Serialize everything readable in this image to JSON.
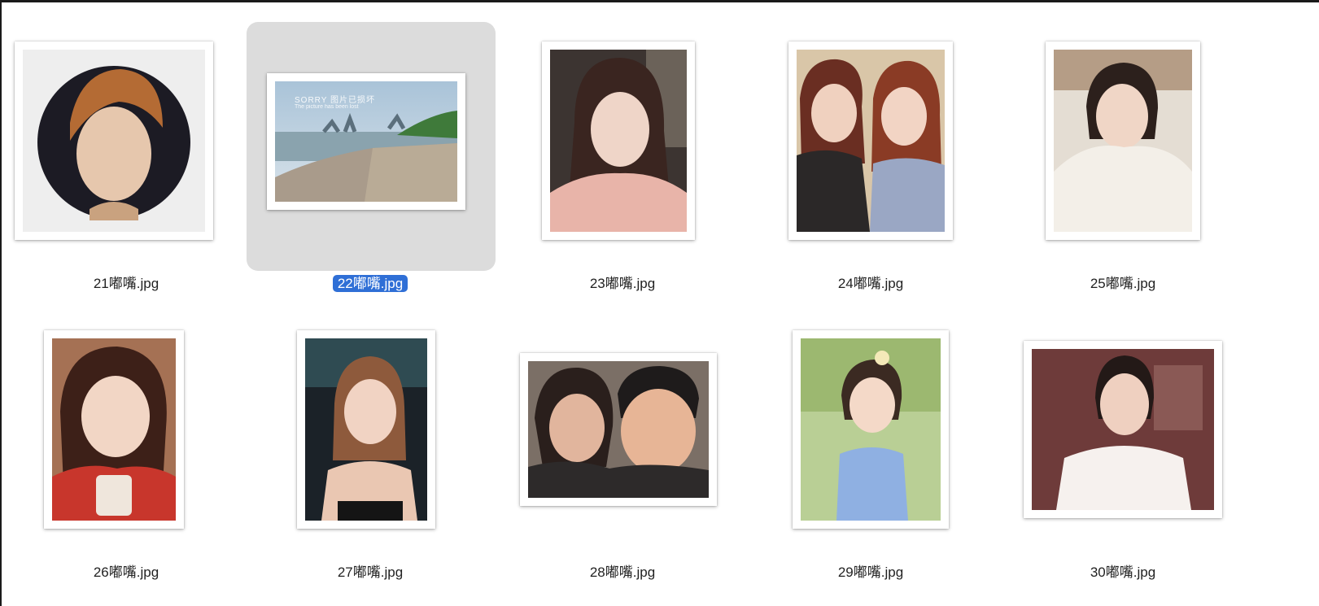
{
  "files": [
    {
      "name": "21嘟嘴.jpg",
      "selected": false
    },
    {
      "name": "22嘟嘴.jpg",
      "selected": true,
      "overlay_text": "SORRY 图片已损坏",
      "overlay_subtext": "The picture has been lost"
    },
    {
      "name": "23嘟嘴.jpg",
      "selected": false
    },
    {
      "name": "24嘟嘴.jpg",
      "selected": false
    },
    {
      "name": "25嘟嘴.jpg",
      "selected": false
    },
    {
      "name": "26嘟嘴.jpg",
      "selected": false
    },
    {
      "name": "27嘟嘴.jpg",
      "selected": false
    },
    {
      "name": "28嘟嘴.jpg",
      "selected": false
    },
    {
      "name": "29嘟嘴.jpg",
      "selected": false
    },
    {
      "name": "30嘟嘴.jpg",
      "selected": false
    }
  ],
  "colors": {
    "selection_bg": "#dcdcdc",
    "label_highlight": "#2f6fd6"
  }
}
